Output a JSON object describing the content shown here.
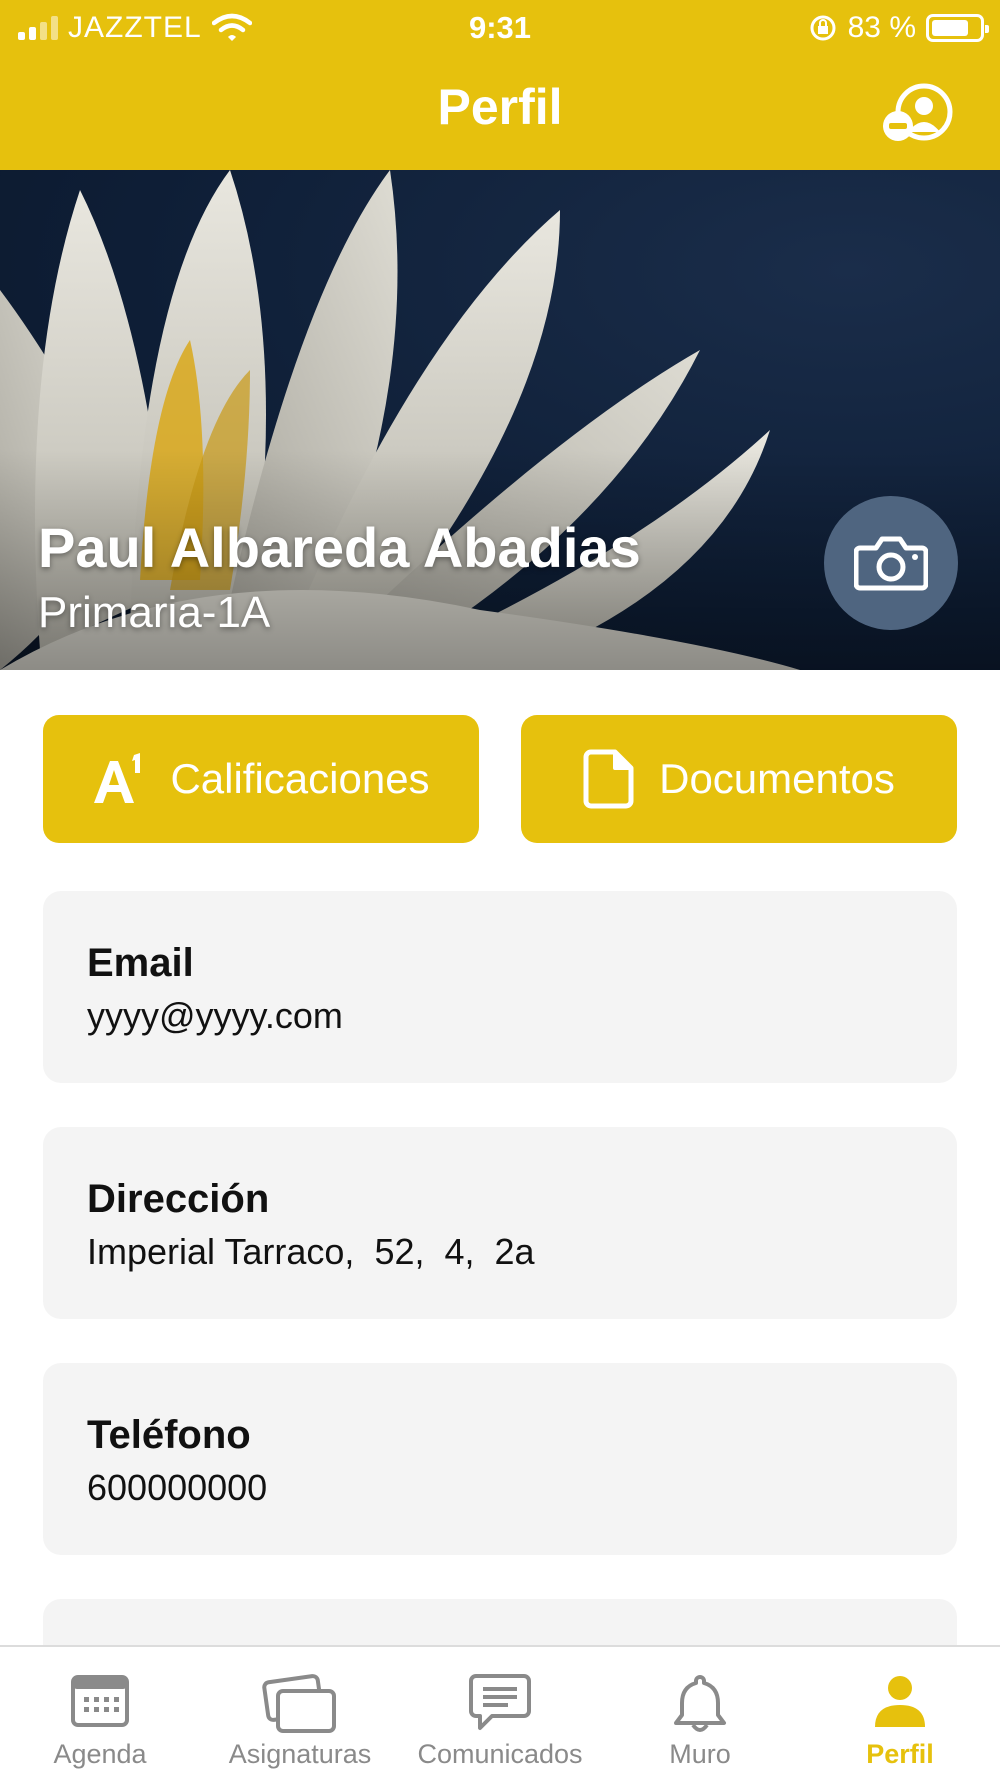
{
  "status_bar": {
    "carrier": "JAZZTEL",
    "time": "9:31",
    "battery": "83 %",
    "battery_level": 0.83
  },
  "header": {
    "title": "Perfil",
    "action_icon": "switch-user-icon"
  },
  "profile": {
    "name": "Paul Albareda Abadias",
    "group": "Primaria-1A",
    "camera_icon": "camera-icon"
  },
  "actions": [
    {
      "label": "Calificaciones",
      "icon": "grades-icon"
    },
    {
      "label": "Documentos",
      "icon": "document-icon"
    }
  ],
  "info": {
    "email": {
      "label": "Email",
      "value": "yyyy@yyyy.com"
    },
    "address": {
      "label": "Dirección",
      "value": "Imperial Tarraco,  52,  4,  2a"
    },
    "phone": {
      "label": "Teléfono",
      "value": "600000000"
    }
  },
  "tabs": [
    {
      "label": "Agenda",
      "icon": "calendar-icon",
      "active": false
    },
    {
      "label": "Asignaturas",
      "icon": "cards-icon",
      "active": false
    },
    {
      "label": "Comunicados",
      "icon": "chat-icon",
      "active": false
    },
    {
      "label": "Muro",
      "icon": "bell-icon",
      "active": false
    },
    {
      "label": "Perfil",
      "icon": "person-icon",
      "active": true
    }
  ],
  "colors": {
    "accent": "#e6c10d",
    "card_bg": "#f4f4f4",
    "camera_bg": "#4f6580",
    "tab_inactive": "#8a8a8a"
  }
}
